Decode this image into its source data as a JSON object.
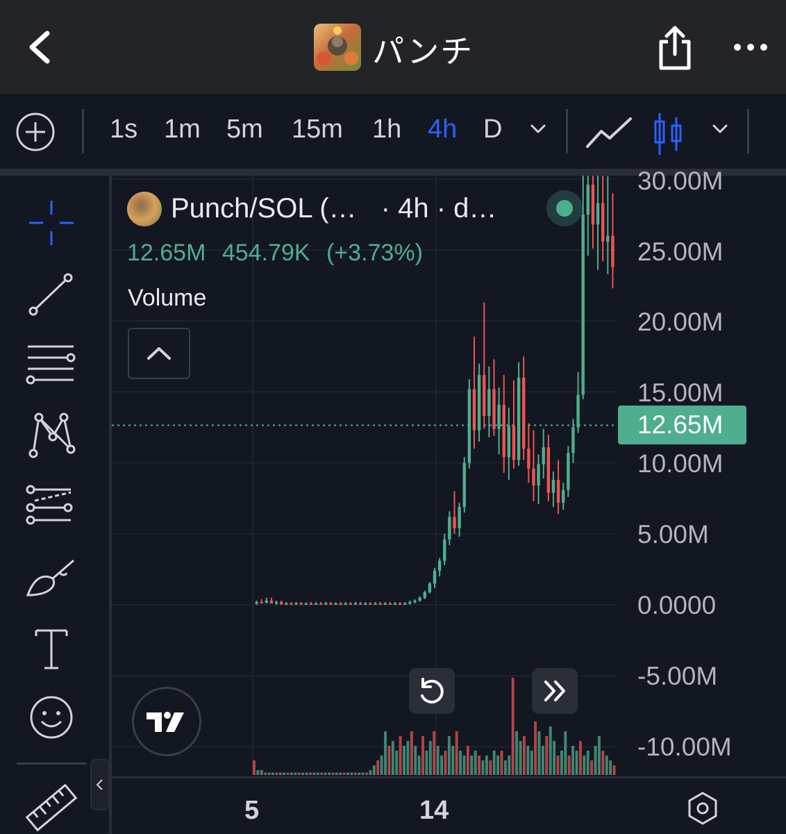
{
  "header": {
    "title": "パンチ",
    "back_icon": "chevron-left-icon",
    "share_icon": "share-icon",
    "more_icon": "more-horizontal-icon"
  },
  "toolbar": {
    "timeframes": [
      "1s",
      "1m",
      "5m",
      "15m",
      "1h",
      "4h",
      "D"
    ],
    "active_timeframe": "4h",
    "chart_types": [
      "line-chart-icon",
      "candlestick-icon"
    ],
    "active_chart_type": "candlestick"
  },
  "drawing_tools": [
    "crosshair-icon",
    "trend-line-icon",
    "horizontal-lines-icon",
    "pattern-icon",
    "fib-tool-icon",
    "brush-icon",
    "text-icon",
    "emoji-icon",
    "ruler-icon"
  ],
  "legend": {
    "symbol": "Punch/SOL (…",
    "interval": "· 4h · d…",
    "price": "12.65M",
    "change": "454.79K",
    "change_pct": "(+3.73%)",
    "study": "Volume"
  },
  "price_axis": {
    "labels": [
      "30.00M",
      "25.00M",
      "20.00M",
      "15.00M",
      "10.00M",
      "5.00M",
      "0.0000",
      "-5.00M",
      "-10.00M"
    ],
    "last_price": "12.65M"
  },
  "time_axis": {
    "labels": [
      "5",
      "14"
    ]
  },
  "colors": {
    "up": "#4fae8f",
    "down": "#ef5350",
    "accent": "#2962ff",
    "background": "#131722"
  },
  "chart_data": {
    "type": "candlestick",
    "ylim": [
      -12000000,
      30000000
    ],
    "last_price": 12650000,
    "candles": [
      {
        "o": 0.1,
        "h": 0.3,
        "l": 0.0,
        "c": 0.2
      },
      {
        "o": 0.2,
        "h": 0.4,
        "l": 0.1,
        "c": 0.15
      },
      {
        "o": 0.15,
        "h": 0.5,
        "l": 0.1,
        "c": 0.3
      },
      {
        "o": 0.3,
        "h": 0.5,
        "l": 0.1,
        "c": 0.1
      },
      {
        "o": 0.1,
        "h": 0.3,
        "l": 0.0,
        "c": 0.2
      },
      {
        "o": 0.2,
        "h": 0.3,
        "l": 0.0,
        "c": 0.05
      },
      {
        "o": 0.05,
        "h": 0.2,
        "l": 0.0,
        "c": 0.1
      },
      {
        "o": 0.1,
        "h": 0.2,
        "l": 0.0,
        "c": 0.05
      },
      {
        "o": 0.05,
        "h": 0.2,
        "l": 0.0,
        "c": 0.12
      },
      {
        "o": 0.12,
        "h": 0.2,
        "l": 0.0,
        "c": 0.06
      },
      {
        "o": 0.06,
        "h": 0.18,
        "l": 0.0,
        "c": 0.1
      },
      {
        "o": 0.1,
        "h": 0.2,
        "l": 0.0,
        "c": 0.08
      },
      {
        "o": 0.08,
        "h": 0.2,
        "l": 0.0,
        "c": 0.1
      },
      {
        "o": 0.1,
        "h": 0.2,
        "l": 0.0,
        "c": 0.05
      },
      {
        "o": 0.05,
        "h": 0.2,
        "l": 0.0,
        "c": 0.12
      },
      {
        "o": 0.12,
        "h": 0.2,
        "l": 0.0,
        "c": 0.08
      },
      {
        "o": 0.08,
        "h": 0.2,
        "l": 0.0,
        "c": 0.1
      },
      {
        "o": 0.1,
        "h": 0.2,
        "l": 0.0,
        "c": 0.06
      },
      {
        "o": 0.06,
        "h": 0.2,
        "l": 0.0,
        "c": 0.1
      },
      {
        "o": 0.1,
        "h": 0.2,
        "l": 0.0,
        "c": 0.07
      },
      {
        "o": 0.07,
        "h": 0.2,
        "l": 0.0,
        "c": 0.12
      },
      {
        "o": 0.12,
        "h": 0.2,
        "l": 0.0,
        "c": 0.08
      },
      {
        "o": 0.08,
        "h": 0.2,
        "l": 0.0,
        "c": 0.1
      },
      {
        "o": 0.1,
        "h": 0.2,
        "l": 0.0,
        "c": 0.06
      },
      {
        "o": 0.06,
        "h": 0.2,
        "l": 0.0,
        "c": 0.1
      },
      {
        "o": 0.1,
        "h": 0.2,
        "l": 0.0,
        "c": 0.05
      },
      {
        "o": 0.05,
        "h": 0.2,
        "l": 0.0,
        "c": 0.1
      },
      {
        "o": 0.1,
        "h": 0.2,
        "l": 0.0,
        "c": 0.06
      },
      {
        "o": 0.06,
        "h": 0.2,
        "l": 0.0,
        "c": 0.1
      },
      {
        "o": 0.1,
        "h": 0.2,
        "l": 0.0,
        "c": 0.08
      },
      {
        "o": 0.08,
        "h": 0.2,
        "l": 0.0,
        "c": 0.1
      },
      {
        "o": 0.1,
        "h": 0.3,
        "l": 0.0,
        "c": 0.2
      },
      {
        "o": 0.2,
        "h": 0.4,
        "l": 0.1,
        "c": 0.3
      },
      {
        "o": 0.3,
        "h": 0.6,
        "l": 0.2,
        "c": 0.5
      },
      {
        "o": 0.5,
        "h": 1.0,
        "l": 0.4,
        "c": 0.9
      },
      {
        "o": 0.9,
        "h": 1.6,
        "l": 0.8,
        "c": 1.5
      },
      {
        "o": 1.5,
        "h": 2.6,
        "l": 1.2,
        "c": 2.4
      },
      {
        "o": 2.4,
        "h": 3.3,
        "l": 2.0,
        "c": 3.1
      },
      {
        "o": 3.1,
        "h": 5.0,
        "l": 2.8,
        "c": 4.6
      },
      {
        "o": 4.6,
        "h": 6.6,
        "l": 4.2,
        "c": 6.2
      },
      {
        "o": 6.2,
        "h": 8.0,
        "l": 5.0,
        "c": 5.4
      },
      {
        "o": 5.4,
        "h": 7.2,
        "l": 4.8,
        "c": 6.9
      },
      {
        "o": 6.9,
        "h": 10.4,
        "l": 6.5,
        "c": 10.0
      },
      {
        "o": 10.0,
        "h": 15.9,
        "l": 9.6,
        "c": 15.2
      },
      {
        "o": 15.2,
        "h": 18.9,
        "l": 11.0,
        "c": 12.3
      },
      {
        "o": 12.3,
        "h": 17.0,
        "l": 11.5,
        "c": 16.2
      },
      {
        "o": 16.2,
        "h": 21.3,
        "l": 12.4,
        "c": 13.3
      },
      {
        "o": 13.3,
        "h": 16.8,
        "l": 11.8,
        "c": 15.2
      },
      {
        "o": 15.2,
        "h": 17.3,
        "l": 11.9,
        "c": 12.4
      },
      {
        "o": 12.4,
        "h": 15.3,
        "l": 10.6,
        "c": 14.1
      },
      {
        "o": 14.1,
        "h": 16.2,
        "l": 9.3,
        "c": 10.4
      },
      {
        "o": 10.4,
        "h": 13.9,
        "l": 8.8,
        "c": 12.6
      },
      {
        "o": 12.6,
        "h": 15.8,
        "l": 9.6,
        "c": 10.2
      },
      {
        "o": 10.2,
        "h": 17.1,
        "l": 9.8,
        "c": 16.0
      },
      {
        "o": 16.0,
        "h": 17.5,
        "l": 10.2,
        "c": 11.0
      },
      {
        "o": 11.0,
        "h": 12.8,
        "l": 8.6,
        "c": 9.6
      },
      {
        "o": 9.6,
        "h": 12.3,
        "l": 7.3,
        "c": 8.4
      },
      {
        "o": 8.4,
        "h": 10.6,
        "l": 7.1,
        "c": 9.9
      },
      {
        "o": 9.9,
        "h": 12.4,
        "l": 8.9,
        "c": 11.1
      },
      {
        "o": 11.1,
        "h": 12.0,
        "l": 7.3,
        "c": 7.9
      },
      {
        "o": 7.9,
        "h": 9.4,
        "l": 6.9,
        "c": 8.8
      },
      {
        "o": 8.8,
        "h": 10.2,
        "l": 6.4,
        "c": 7.2
      },
      {
        "o": 7.2,
        "h": 8.6,
        "l": 6.7,
        "c": 8.1
      },
      {
        "o": 8.1,
        "h": 11.2,
        "l": 7.6,
        "c": 10.7
      },
      {
        "o": 10.7,
        "h": 13.1,
        "l": 10.0,
        "c": 12.5
      },
      {
        "o": 12.5,
        "h": 16.4,
        "l": 12.1,
        "c": 14.8
      },
      {
        "o": 14.8,
        "h": 31.0,
        "l": 14.5,
        "c": 27.5
      },
      {
        "o": 27.5,
        "h": 31.0,
        "l": 24.6,
        "c": 29.6
      },
      {
        "o": 29.6,
        "h": 31.0,
        "l": 25.1,
        "c": 26.8
      },
      {
        "o": 26.8,
        "h": 31.0,
        "l": 23.6,
        "c": 28.3
      },
      {
        "o": 28.3,
        "h": 31.0,
        "l": 24.2,
        "c": 25.6
      },
      {
        "o": 25.6,
        "h": 30.2,
        "l": 23.3,
        "c": 26.0
      },
      {
        "o": 26.0,
        "h": 29.0,
        "l": 22.3,
        "c": 23.8
      }
    ],
    "volume_hist": [
      0.3,
      0.1,
      0.1,
      0.05,
      0.05,
      0.05,
      0.05,
      0.05,
      0.05,
      0.05,
      0.05,
      0.05,
      0.05,
      0.05,
      0.05,
      0.05,
      0.05,
      0.05,
      0.05,
      0.05,
      0.05,
      0.05,
      0.05,
      0.05,
      0.05,
      0.05,
      0.05,
      0.05,
      0.05,
      0.05,
      0.05,
      0.1,
      0.2,
      0.3,
      0.4,
      0.9,
      0.6,
      0.7,
      0.5,
      0.8,
      0.6,
      0.7,
      0.9,
      0.6,
      0.4,
      0.8,
      0.5,
      0.7,
      0.9,
      0.6,
      0.4,
      0.5,
      0.8,
      0.6,
      0.9,
      0.5,
      0.4,
      0.6,
      0.4,
      0.5,
      0.4,
      0.3,
      0.4,
      0.3,
      0.5,
      0.4,
      0.5,
      0.3,
      0.4,
      2.0,
      0.9,
      0.7,
      0.8,
      0.6,
      0.5,
      1.1,
      0.9,
      0.6,
      0.8,
      1.0,
      0.7,
      0.4,
      0.5,
      0.9,
      0.4,
      0.6,
      0.5,
      0.7,
      0.4,
      0.5,
      0.3,
      0.6,
      0.8,
      0.5,
      0.4,
      0.3,
      0.2
    ]
  }
}
